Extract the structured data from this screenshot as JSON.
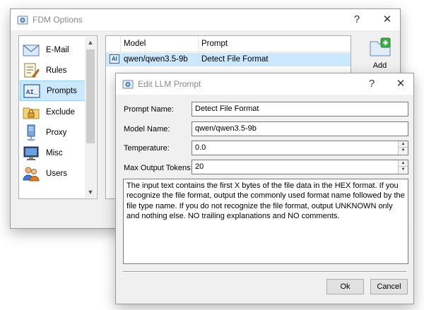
{
  "main_window": {
    "title": "FDM Options",
    "help_label": "?",
    "close_label": "✕",
    "sidebar": {
      "items": [
        {
          "label": "E-Mail",
          "icon": "envelope-icon"
        },
        {
          "label": "Rules",
          "icon": "rules-icon"
        },
        {
          "label": "Prompts",
          "icon": "prompt-icon",
          "selected": true
        },
        {
          "label": "Exclude",
          "icon": "folder-lock-icon"
        },
        {
          "label": "Proxy",
          "icon": "proxy-icon"
        },
        {
          "label": "Misc",
          "icon": "monitor-icon"
        },
        {
          "label": "Users",
          "icon": "users-icon"
        }
      ]
    },
    "list": {
      "columns": [
        "Model",
        "Prompt"
      ],
      "rows": [
        {
          "badge": "AI",
          "model": "qwen/qwen3.5-9b",
          "prompt": "Detect File Format"
        }
      ]
    },
    "add_button_label": "Add"
  },
  "dialog": {
    "title": "Edit LLM Prompt",
    "help_label": "?",
    "close_label": "✕",
    "fields": {
      "prompt_name_label": "Prompt Name:",
      "prompt_name_value": "Detect File Format",
      "model_name_label": "Model Name:",
      "model_name_value": "qwen/qwen3.5-9b",
      "temperature_label": "Temperature:",
      "temperature_value": "0.0",
      "max_tokens_label": "Max Output Tokens:",
      "max_tokens_value": "20"
    },
    "prompt_text": "The input text contains the first X bytes of the file data in the HEX format. If you recognize the file format, output the commonly used format name followed by the file type name. If you do not recognize the file format, output UNKNOWN only and nothing else. NO trailing explanations and NO comments.",
    "ok_label": "Ok",
    "cancel_label": "Cancel"
  },
  "colors": {
    "selection": "#cce8ff",
    "window_bg": "#f0f0f0",
    "title_text": "#8a8a8a"
  }
}
